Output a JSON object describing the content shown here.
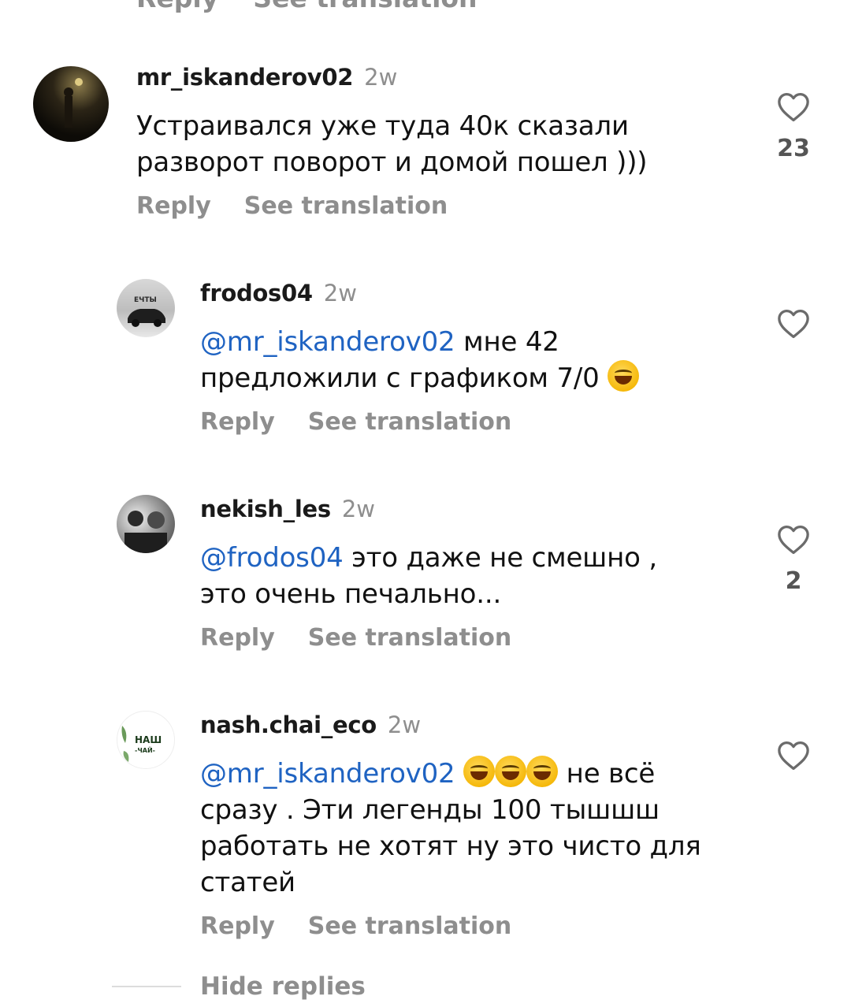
{
  "top_cut": {
    "reply": "Reply",
    "translate": "See translation"
  },
  "comments": [
    {
      "username": "mr_iskanderov02",
      "time": "2w",
      "text": "Устраивался уже туда 40к  сказали\nразворот поворот и домой пошел )))",
      "like_count": "23",
      "reply": "Reply",
      "translate": "See translation"
    },
    {
      "username": "frodos04",
      "time": "2w",
      "mention": "@mr_iskanderov02",
      "text": " мне 42\nпредложили с графиком 7/0 ",
      "reply": "Reply",
      "translate": "See translation",
      "avatar_caption": "ЕЧТЫ"
    },
    {
      "username": "nekish_les",
      "time": "2w",
      "mention": "@frodos04",
      "text": " это даже не смешно ,\nэто очень печально...",
      "like_count": "2",
      "reply": "Reply",
      "translate": "See translation"
    },
    {
      "username": "nash.chai_eco",
      "time": "2w",
      "mention": "@mr_iskanderov02",
      "text_after_emoji": " не всё",
      "text_rest": "сразу .  Эти легенды 100 тышшш\nработать не хотят ну это чисто для\nстатей",
      "reply": "Reply",
      "translate": "See translation",
      "avatar_caption": {
        "line1": "НАШ",
        "line2": "-ЧАЙ-"
      }
    }
  ],
  "hide_replies": "Hide replies",
  "colors": {
    "mention": "#1f63c2",
    "muted": "#8e8e8e"
  }
}
